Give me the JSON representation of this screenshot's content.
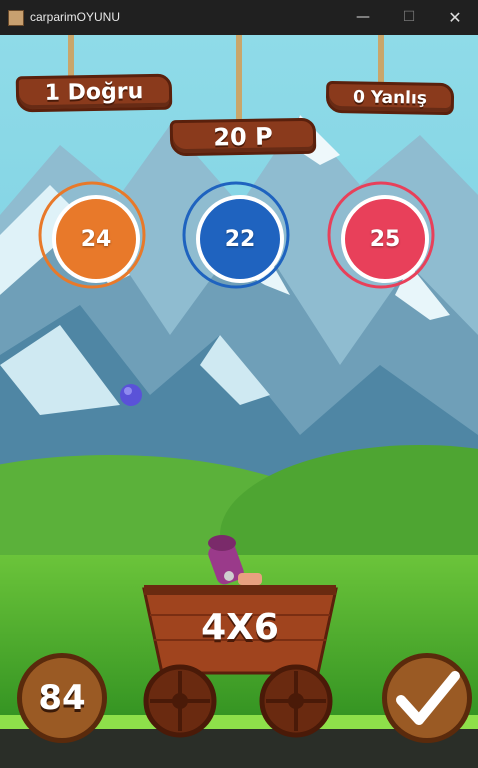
{
  "window": {
    "title": "carparimOYUNU",
    "minimize": "—",
    "maximize": "☐",
    "close": "✕",
    "icon": "app-icon"
  },
  "scoreboard": {
    "correct": "1 Doğru",
    "wrong": "0 Yanlış",
    "points": "20 P"
  },
  "answers": [
    {
      "value": "24",
      "color": "#e8792a"
    },
    {
      "value": "22",
      "color": "#1f63bf"
    },
    {
      "value": "25",
      "color": "#e8405a"
    }
  ],
  "question": "4X6",
  "timer": "84",
  "submit_icon": "checkmark-icon",
  "colors": {
    "sky": "#7fd2e6",
    "grass": "#3fae2a",
    "wood": "#8a3a1c"
  }
}
